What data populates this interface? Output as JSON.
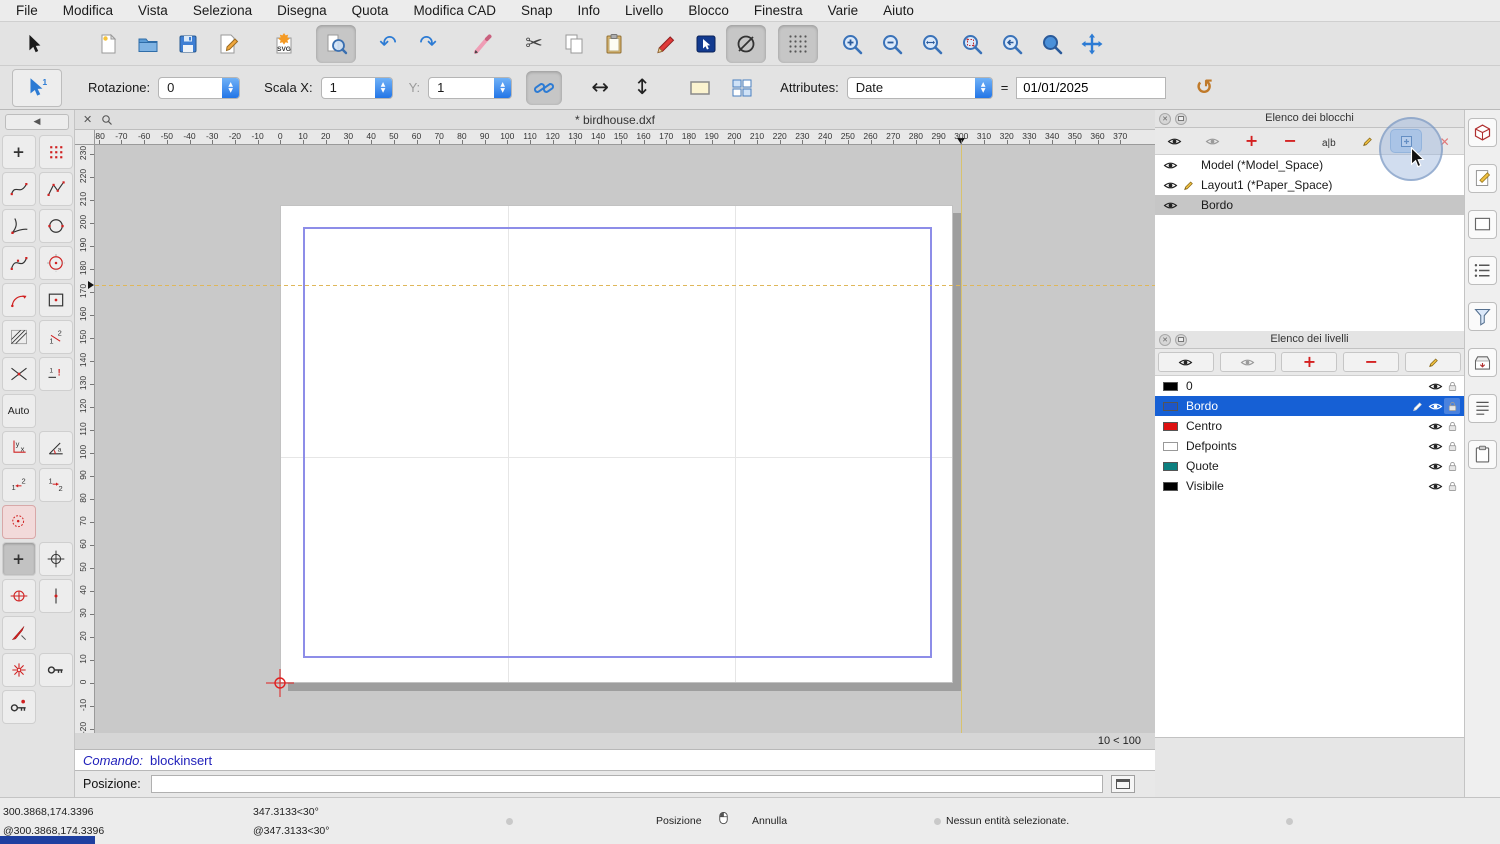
{
  "menu": {
    "items": [
      "File",
      "Modifica",
      "Vista",
      "Seleziona",
      "Disegna",
      "Quota",
      "Modifica CAD",
      "Snap",
      "Info",
      "Livello",
      "Blocco",
      "Finestra",
      "Varie",
      "Aiuto"
    ]
  },
  "toolbar_main": {
    "buttons": [
      {
        "name": "selection-pointer",
        "glyph": "cursor"
      },
      {
        "sep": true,
        "w": 34
      },
      {
        "name": "new-file",
        "glyph": "page"
      },
      {
        "name": "open-file",
        "glyph": "folder"
      },
      {
        "name": "save-file",
        "glyph": "floppy"
      },
      {
        "name": "edit-drawing-preferences",
        "glyph": "pagepen"
      },
      {
        "sep": true,
        "w": 16
      },
      {
        "name": "svg-export",
        "glyph": "svg"
      },
      {
        "sep": true,
        "w": 12
      },
      {
        "name": "print-preview",
        "glyph": "preview",
        "pressed": true
      },
      {
        "sep": true,
        "w": 12
      },
      {
        "name": "undo",
        "glyph": "undo"
      },
      {
        "name": "redo",
        "glyph": "redo"
      },
      {
        "sep": true,
        "w": 14
      },
      {
        "name": "pencil-tool",
        "glyph": "lead"
      },
      {
        "sep": true,
        "w": 12
      },
      {
        "name": "cut",
        "glyph": "scissors"
      },
      {
        "name": "copy",
        "glyph": "copy"
      },
      {
        "name": "paste",
        "glyph": "paste"
      },
      {
        "sep": true,
        "w": 12
      },
      {
        "name": "draw-pen",
        "glyph": "redpen"
      },
      {
        "name": "selection-mode",
        "glyph": "selbox"
      },
      {
        "name": "restrict-nothing",
        "glyph": "noslash",
        "pressed": true
      },
      {
        "sep": true,
        "w": 12
      },
      {
        "name": "grid-toggle",
        "glyph": "griddots",
        "pressed": true
      },
      {
        "sep": true,
        "w": 14
      },
      {
        "name": "zoom-in",
        "glyph": "zoomin"
      },
      {
        "name": "zoom-out",
        "glyph": "zoomout"
      },
      {
        "name": "auto-zoom",
        "glyph": "zoomfit"
      },
      {
        "name": "zoom-selection",
        "glyph": "zoomsel"
      },
      {
        "name": "zoom-previous",
        "glyph": "zoomprev"
      },
      {
        "name": "zoom-window",
        "glyph": "zoomwin"
      },
      {
        "name": "pan",
        "glyph": "pan"
      }
    ]
  },
  "options_bar": {
    "rotation_label": "Rotazione:",
    "rotation_value": "0",
    "scale_x_label": "Scala X:",
    "scale_x_value": "1",
    "scale_y_label": "Y:",
    "scale_y_value": "1",
    "attributes_label": "Attributes:",
    "attributes_value": "Date",
    "equals_sign": "=",
    "attribute_date_value": "01/01/2025"
  },
  "toolbox": {
    "auto_label": "Auto",
    "tools": [
      {
        "name": "point-tool",
        "glyph": "plus"
      },
      {
        "name": "point-grid-tool",
        "glyph": "dots"
      },
      {
        "name": "freehand-line-tool",
        "glyph": "wave"
      },
      {
        "name": "polyline-tool",
        "glyph": "poly"
      },
      {
        "name": "arc-tangent-tool",
        "glyph": "fork"
      },
      {
        "name": "circle-2point-tool",
        "glyph": "circle2"
      },
      {
        "name": "spline-tool",
        "glyph": "spline"
      },
      {
        "name": "circle-center-tool",
        "glyph": "ccenter"
      },
      {
        "name": "arc-tool",
        "glyph": "arcarrow"
      },
      {
        "name": "rectangle-tool",
        "glyph": "rectdot"
      },
      {
        "name": "hatch-tool",
        "glyph": "hatch"
      },
      {
        "name": "dimension-ratio-tool",
        "glyph": "two1"
      },
      {
        "name": "intersection-tool",
        "glyph": "crosslines"
      },
      {
        "name": "leader-tool",
        "glyph": "oneex"
      },
      {
        "name": "auto-snap-button",
        "glyph": "AUTO",
        "auto": true
      },
      {
        "name": "",
        "glyph": ""
      },
      {
        "name": "cartesian-coordinate-tool",
        "glyph": "yx"
      },
      {
        "name": "polar-coordinate-tool",
        "glyph": "angle"
      },
      {
        "name": "ordinate-dimension-tool-1",
        "glyph": "half1"
      },
      {
        "name": "ordinate-dimension-tool-2",
        "glyph": "half2"
      },
      {
        "name": "snap-selection-tool",
        "glyph": "redsel",
        "tint": "pink"
      },
      {
        "name": "",
        "glyph": ""
      },
      {
        "name": "snap-free-tool",
        "glyph": "plusd",
        "pressed": true
      },
      {
        "name": "snap-grid-tool",
        "glyph": "crossh"
      },
      {
        "name": "snap-center-tool",
        "glyph": "cplus"
      },
      {
        "name": "snap-endpoint-tool",
        "glyph": "vdot"
      },
      {
        "name": "snap-needle-tool",
        "glyph": "needle"
      },
      {
        "name": "",
        "glyph": ""
      },
      {
        "name": "snap-reference-tool",
        "glyph": "snapred"
      },
      {
        "name": "relative-zero-lock-tool",
        "glyph": "key1"
      },
      {
        "name": "relative-zero-tool",
        "glyph": "key2"
      },
      {
        "name": "",
        "glyph": ""
      }
    ]
  },
  "document": {
    "tab_title": "* birdhouse.dxf",
    "close_glyph": "✕",
    "zoom_hint": "10 < 100"
  },
  "rulers": {
    "horizontal": {
      "from": -80,
      "to": 370,
      "step": 10
    },
    "vertical": {
      "from": 230,
      "to": -20,
      "step": 10
    }
  },
  "command_line": {
    "prompt_label": "Comando:",
    "command": "blockinsert",
    "position_label": "Posizione:",
    "position_value": ""
  },
  "blocks_panel": {
    "title": "Elenco dei blocchi",
    "toolbar": [
      {
        "name": "show-all-blocks",
        "glyph": "eye"
      },
      {
        "name": "hide-all-blocks",
        "glyph": "eyegray"
      },
      {
        "name": "add-block",
        "glyph": "plusred"
      },
      {
        "name": "remove-block",
        "glyph": "minusred"
      },
      {
        "name": "rename-block",
        "glyph": "alb"
      },
      {
        "name": "edit-block",
        "glyph": "pencil"
      },
      {
        "name": "insert-block",
        "glyph": "insblock",
        "highlighted": true
      },
      {
        "name": "close-block-edit",
        "glyph": "xred"
      }
    ],
    "items": [
      {
        "label": "Model (*Model_Space)",
        "editing": false,
        "selected": false
      },
      {
        "label": "Layout1 (*Paper_Space)",
        "editing": true,
        "selected": false
      },
      {
        "label": "Bordo",
        "editing": false,
        "selected": true
      }
    ]
  },
  "layers_panel": {
    "title": "Elenco dei livelli",
    "toolbar": [
      {
        "name": "show-all-layers",
        "glyph": "eye"
      },
      {
        "name": "hide-all-layers",
        "glyph": "eyegray"
      },
      {
        "name": "add-layer",
        "glyph": "plusred"
      },
      {
        "name": "remove-layer",
        "glyph": "minusred"
      },
      {
        "name": "edit-layer",
        "glyph": "pencil"
      }
    ],
    "items": [
      {
        "label": "0",
        "color": "#000000",
        "selected": false
      },
      {
        "label": "Bordo",
        "color": "#1d56c8",
        "selected": true
      },
      {
        "label": "Centro",
        "color": "#dd1111",
        "selected": false
      },
      {
        "label": "Defpoints",
        "color": "#ffffff",
        "selected": false
      },
      {
        "label": "Quote",
        "color": "#0c7f7f",
        "selected": false
      },
      {
        "label": "Visibile",
        "color": "#000000",
        "selected": false
      }
    ]
  },
  "side_strip": [
    {
      "name": "library-browser",
      "glyph": "rs_cube"
    },
    {
      "name": "property-editor",
      "glyph": "rs_page"
    },
    {
      "name": "view-widget",
      "glyph": "rs_rect"
    },
    {
      "name": "block-list-toggle",
      "glyph": "rs_list"
    },
    {
      "name": "selection-filter",
      "glyph": "rs_funnel"
    },
    {
      "name": "block-insert-panel",
      "glyph": "rs_box"
    },
    {
      "name": "layer-list-toggle",
      "glyph": "rs_list2"
    },
    {
      "name": "clipboard-panel",
      "glyph": "rs_clip"
    }
  ],
  "status_bar": {
    "abs_coord": "300.3868,174.3396",
    "rel_coord": "@300.3868,174.3396",
    "abs_polar": "347.3133<30°",
    "rel_polar": "@347.3133<30°",
    "position_label": "Posizione",
    "cancel_label": "Annulla",
    "selection_status": "Nessun entità selezionate."
  },
  "colors": {
    "selection_blue": "#1660d5",
    "border_rect_purple": "#8d8de8",
    "crosshair_orange": "#dfb75a",
    "origin_red": "#e02020",
    "highlight_circle": "#98b4dc"
  }
}
